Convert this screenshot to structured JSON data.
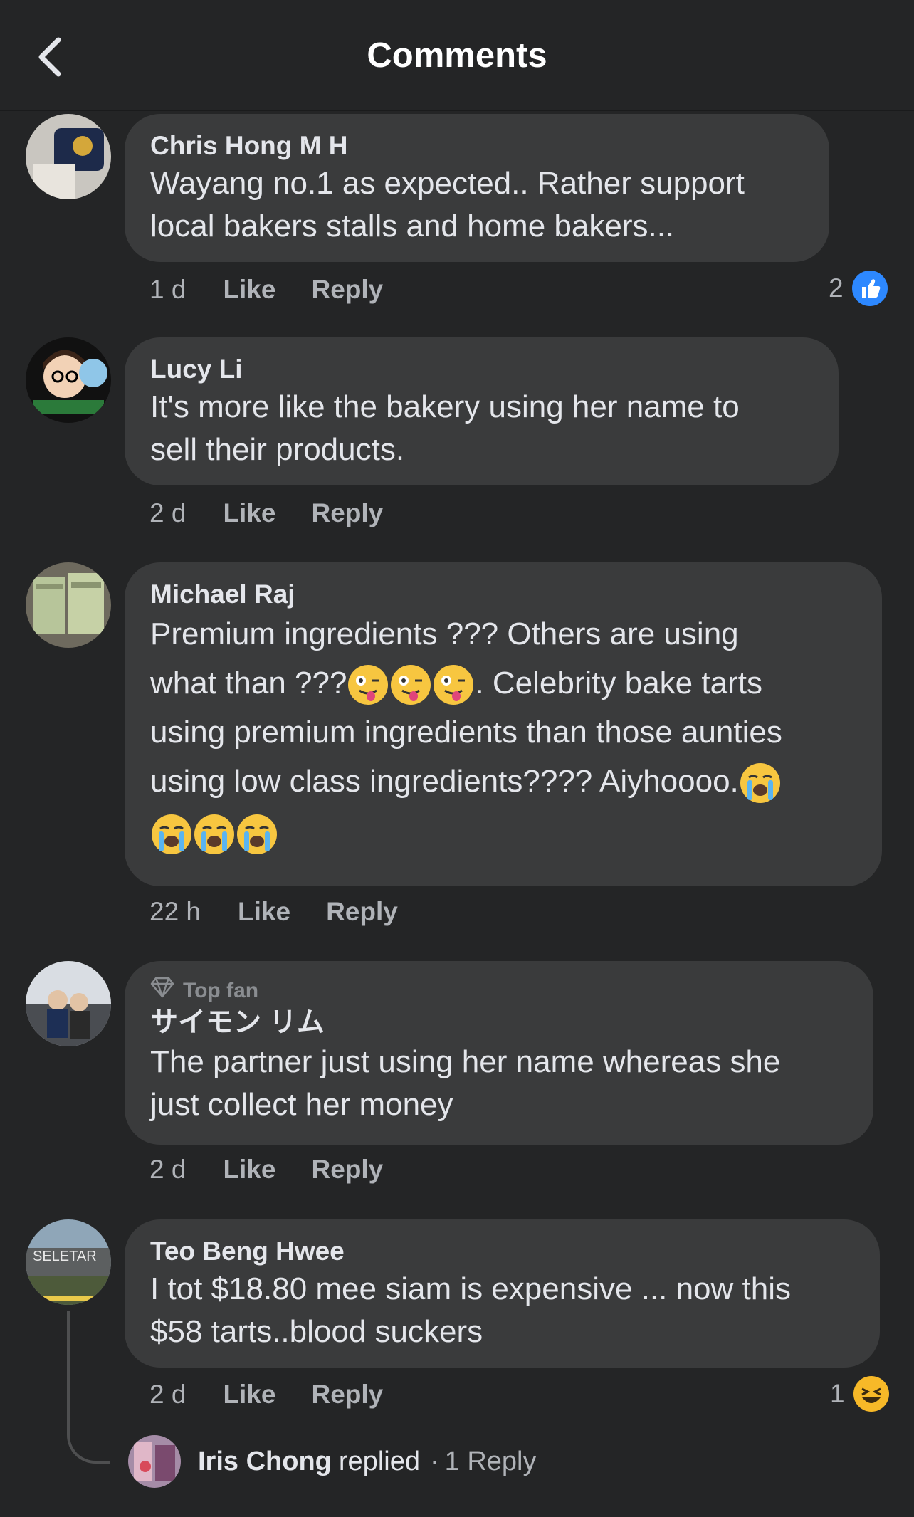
{
  "header": {
    "title": "Comments",
    "back_icon": "chevron-left-icon"
  },
  "comments": [
    {
      "author": "Chris Hong M H",
      "lines": [
        "Wayang no.1 as expected.. Rather support",
        "local bakers stalls and home bakers..."
      ],
      "time": "1 d",
      "like_label": "Like",
      "reply_label": "Reply",
      "reaction_count": "2",
      "reaction_icon": "like-icon"
    },
    {
      "author": "Lucy Li",
      "lines": [
        "It's more like the bakery using  her name to",
        "sell their products."
      ],
      "time": "2 d",
      "like_label": "Like",
      "reply_label": "Reply"
    },
    {
      "author": "Michael Raj",
      "lines": [
        "Premium ingredients ??? Others are using",
        "what than ???",
        ". Celebrity bake tarts",
        "using premium ingredients than those aunties",
        "using low class ingredients???? Aiyhoooo."
      ],
      "emojis": [
        "winking-tongue-emoji",
        "crying-emoji"
      ],
      "time": "22 h",
      "like_label": "Like",
      "reply_label": "Reply"
    },
    {
      "badge": "Top fan",
      "author": "サイモン リム",
      "lines": [
        "The partner just using her name whereas she",
        "just collect her money"
      ],
      "time": "2 d",
      "like_label": "Like",
      "reply_label": "Reply"
    },
    {
      "author": "Teo Beng Hwee",
      "lines": [
        "I tot $18.80 mee siam is expensive ... now this",
        "$58 tarts..blood suckers"
      ],
      "time": "2 d",
      "like_label": "Like",
      "reply_label": "Reply",
      "reaction_count": "1",
      "reaction_icon": "haha-icon"
    }
  ],
  "reply_summary": {
    "name": "Iris Chong",
    "verb": "replied",
    "separator": "·",
    "count": "1 Reply"
  },
  "colors": {
    "background": "#242526",
    "bubble": "#3a3b3c",
    "text": "#e4e6eb",
    "muted": "#b0b3b8",
    "like_blue": "#2d88ff",
    "haha_yellow": "#f7b928"
  }
}
